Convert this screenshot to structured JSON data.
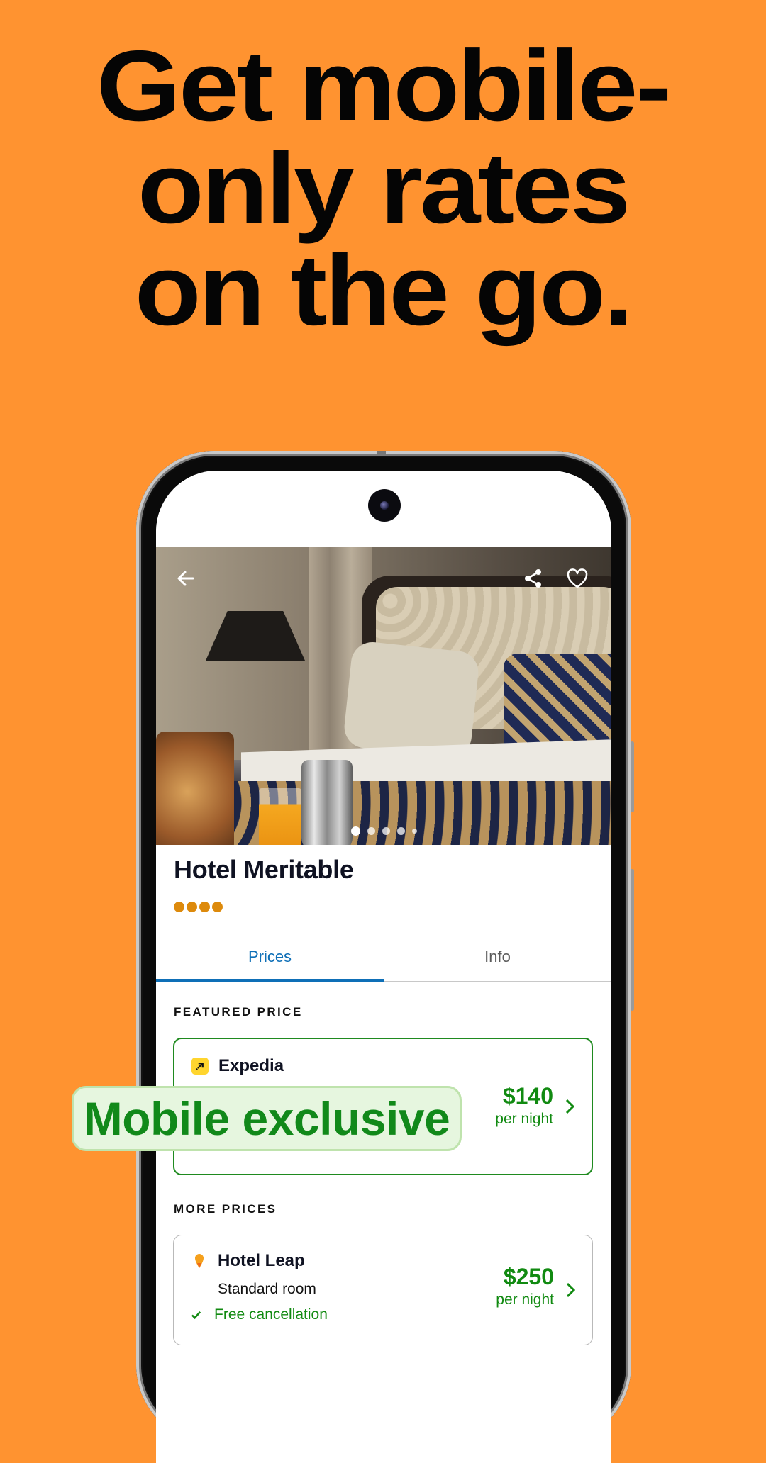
{
  "headline": {
    "lines": [
      "Get mobile-",
      "only rates",
      "on the go."
    ]
  },
  "colors": {
    "background": "#FF9330",
    "accent_blue": "#0e6fb7",
    "price_green": "#118a11",
    "rating_orange": "#DD8A0C",
    "expedia_yellow": "#FFD52E"
  },
  "hero": {
    "back_icon": "arrow-left-icon",
    "share_icon": "share-icon",
    "favorite_icon": "heart-outline-icon",
    "carousel": {
      "total": 5,
      "active_index": 0
    }
  },
  "hotel": {
    "name": "Hotel Meritable",
    "rating": 4
  },
  "tabs": [
    {
      "label": "Prices",
      "active": true
    },
    {
      "label": "Info",
      "active": false
    }
  ],
  "featured": {
    "section_label": "FEATURED PRICE",
    "provider": "Expedia",
    "price": "$140",
    "per_night": "per night"
  },
  "more": {
    "section_label": "MORE PRICES",
    "items": [
      {
        "provider": "Hotel Leap",
        "room": "Standard room",
        "cancellation": "Free cancellation",
        "price": "$250",
        "per_night": "per night"
      }
    ]
  },
  "badge": {
    "label": "Mobile exclusive"
  }
}
